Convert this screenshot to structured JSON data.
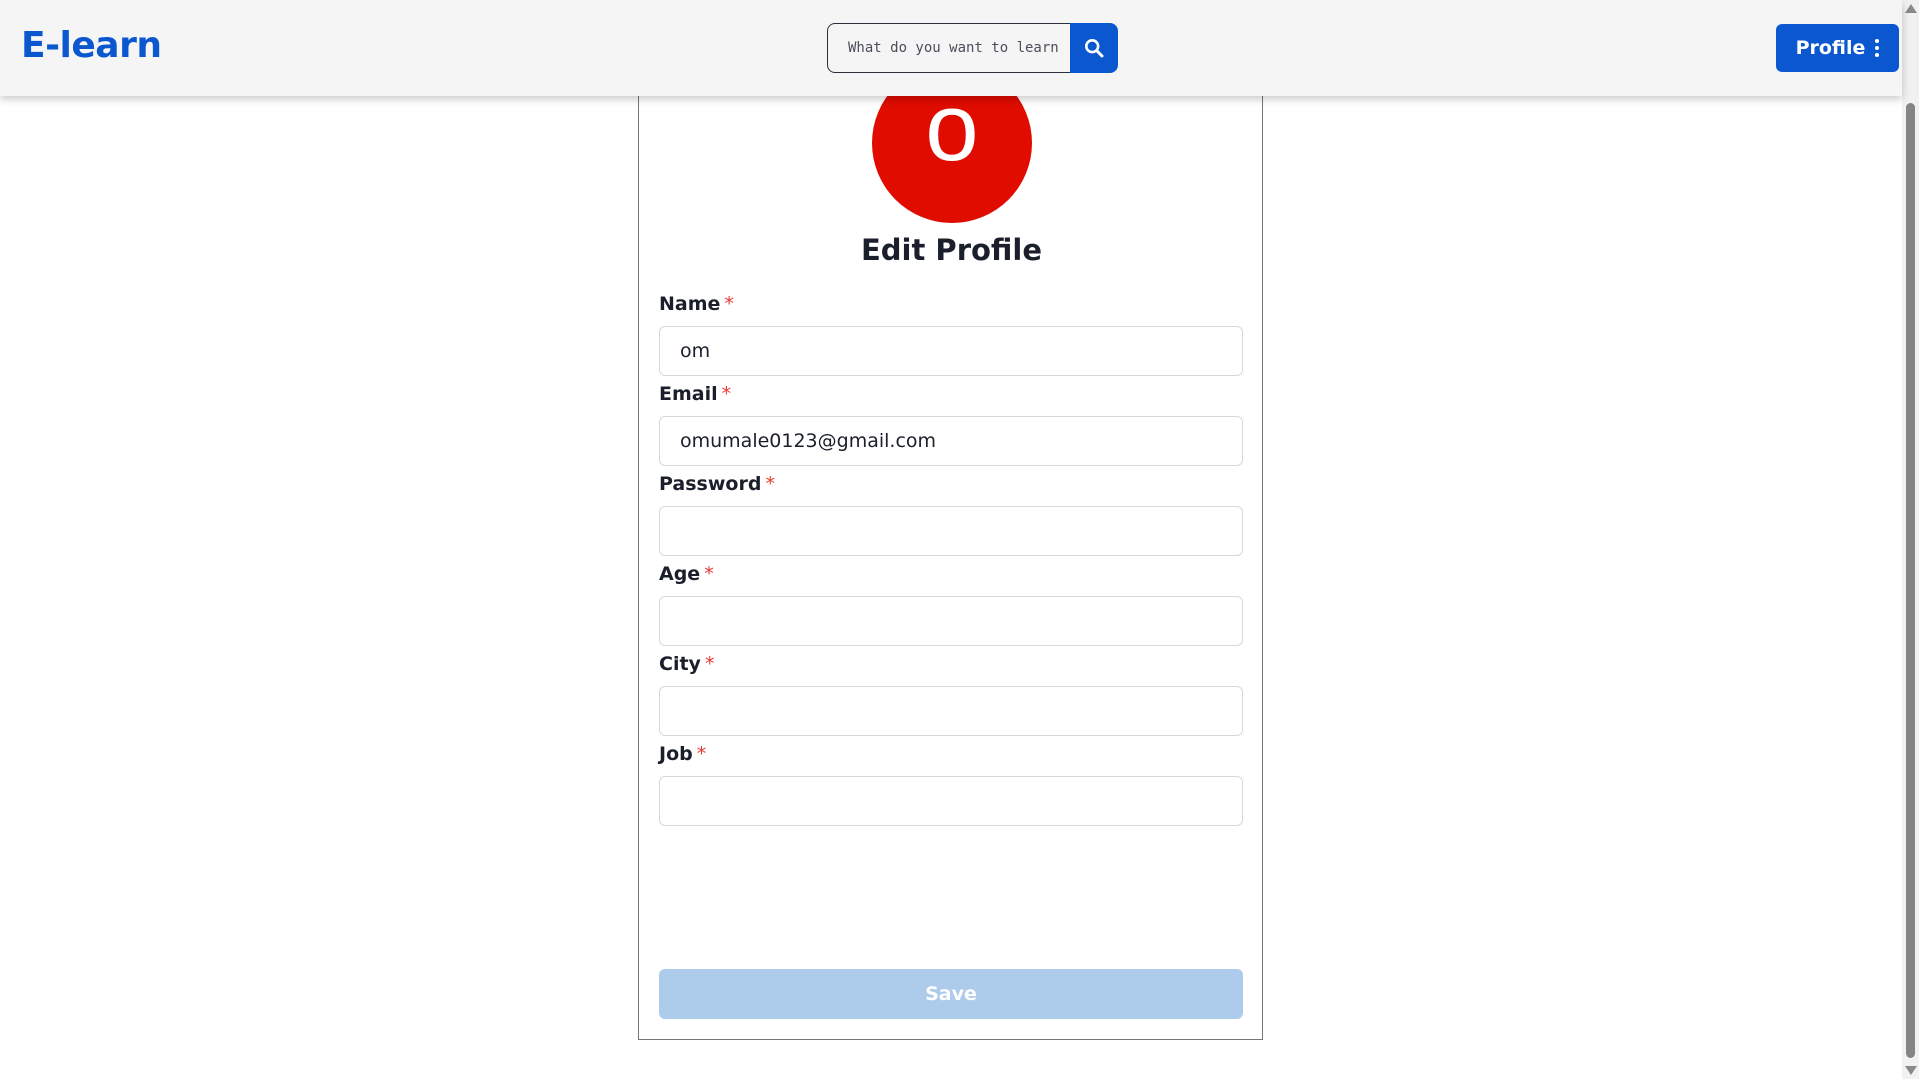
{
  "header": {
    "brand": "E-learn",
    "search": {
      "placeholder": "What do you want to learn?",
      "value": ""
    },
    "search_icon": "search-icon",
    "profile_label": "Profile",
    "profile_menu_icon": "kebab-menu-icon"
  },
  "profile": {
    "avatar_letter": "o",
    "avatar_color": "#e00c00",
    "title": "Edit Profile",
    "fields": [
      {
        "label": "Name",
        "required_mark": "*",
        "value": "om"
      },
      {
        "label": "Email",
        "required_mark": "*",
        "value": "omumale0123@gmail.com"
      },
      {
        "label": "Password",
        "required_mark": "*",
        "value": ""
      },
      {
        "label": "Age",
        "required_mark": "*",
        "value": ""
      },
      {
        "label": "City",
        "required_mark": "*",
        "value": ""
      },
      {
        "label": "Job",
        "required_mark": "*",
        "value": ""
      }
    ],
    "save_label": "Save"
  },
  "colors": {
    "brand": "#0b57d0",
    "required": "#e53935",
    "save_disabled": "#adcbea",
    "header_bg": "#f5f5f6"
  }
}
